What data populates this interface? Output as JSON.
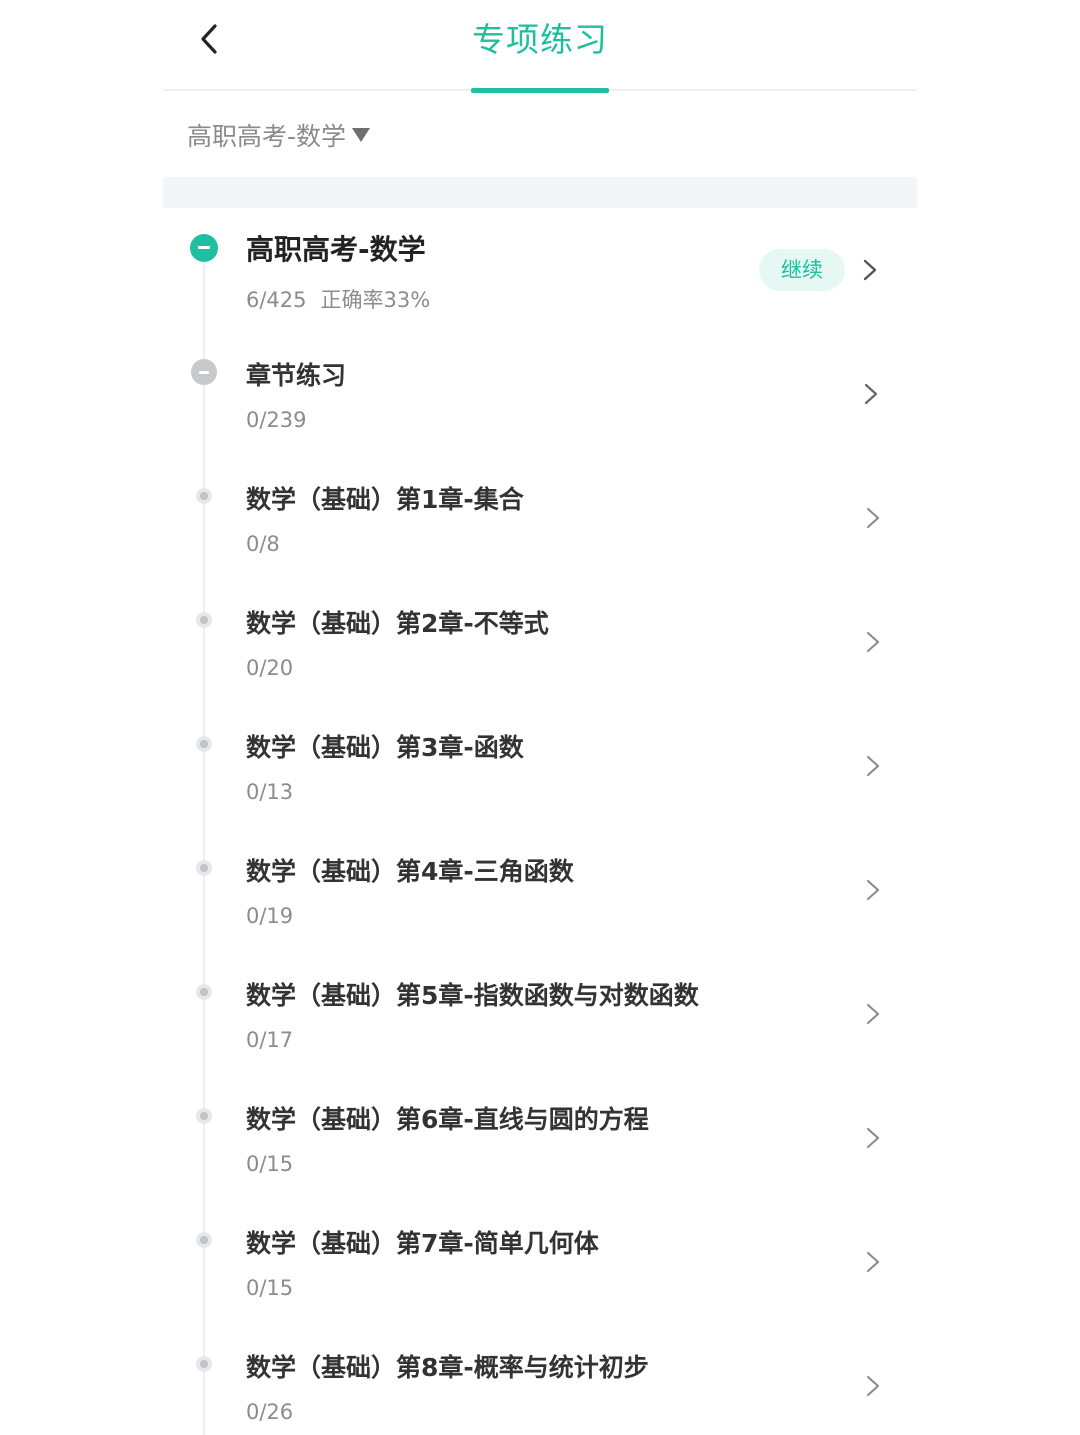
{
  "header": {
    "title": "专项练习",
    "back_icon": "chevron-left-icon"
  },
  "subject_selector": {
    "label": "高职高考-数学",
    "caret_icon": "caret-down-icon"
  },
  "colors": {
    "accent": "#1fbe9f",
    "continue_bg": "#e6f8f3",
    "band": "#f4f5f8"
  },
  "tree": {
    "root": {
      "name": "高职高考-数学",
      "progress": "6/425",
      "accuracy": "正确率33%",
      "continue_label": "继续"
    },
    "group": {
      "name": "章节练习",
      "progress": "0/239"
    },
    "chapters": [
      {
        "name": "数学（基础）第1章-集合",
        "progress": "0/8"
      },
      {
        "name": "数学（基础）第2章-不等式",
        "progress": "0/20"
      },
      {
        "name": "数学（基础）第3章-函数",
        "progress": "0/13"
      },
      {
        "name": "数学（基础）第4章-三角函数",
        "progress": "0/19"
      },
      {
        "name": "数学（基础）第5章-指数函数与对数函数",
        "progress": "0/17"
      },
      {
        "name": "数学（基础）第6章-直线与圆的方程",
        "progress": "0/15"
      },
      {
        "name": "数学（基础）第7章-简单几何体",
        "progress": "0/15"
      },
      {
        "name": "数学（基础）第8章-概率与统计初步",
        "progress": "0/26"
      }
    ]
  }
}
